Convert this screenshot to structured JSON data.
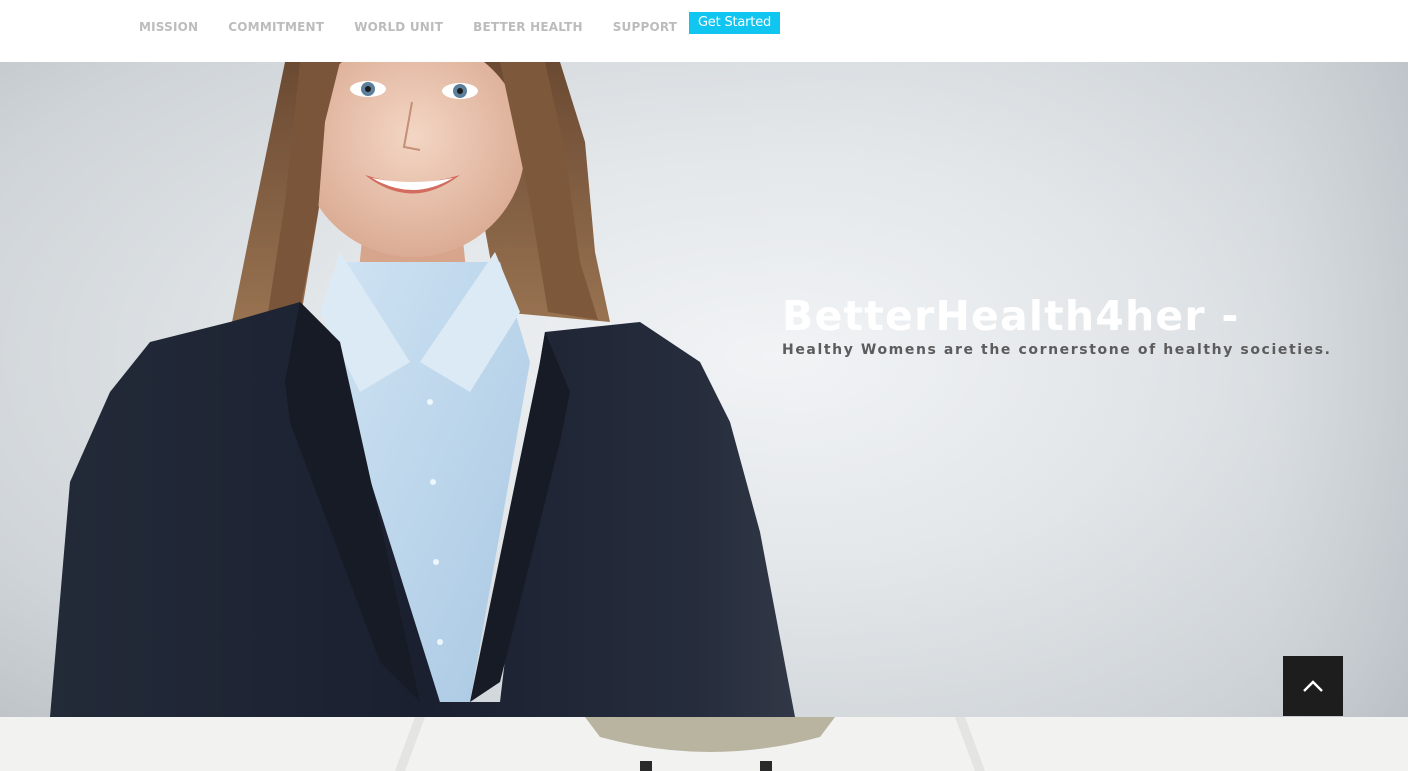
{
  "nav": {
    "links": [
      {
        "label": "MISSION"
      },
      {
        "label": "COMMITMENT"
      },
      {
        "label": "WORLD UNIT"
      },
      {
        "label": "BETTER HEALTH"
      },
      {
        "label": "SUPPORT"
      }
    ],
    "cta_label": "Get Started"
  },
  "hero": {
    "title": "BetterHealth4her -",
    "subtitle": "Healthy Womens are the cornerstone of healthy societies.",
    "image": "woman-in-business-suit-photo"
  },
  "scroll_top": {
    "icon": "chevron-up-icon"
  },
  "colors": {
    "accent": "#10c6f0",
    "nav_text": "#bcbcbc",
    "hero_title": "#ffffff",
    "hero_subtitle": "#5c5c5c",
    "scroll_button": "#1d1d1d"
  }
}
